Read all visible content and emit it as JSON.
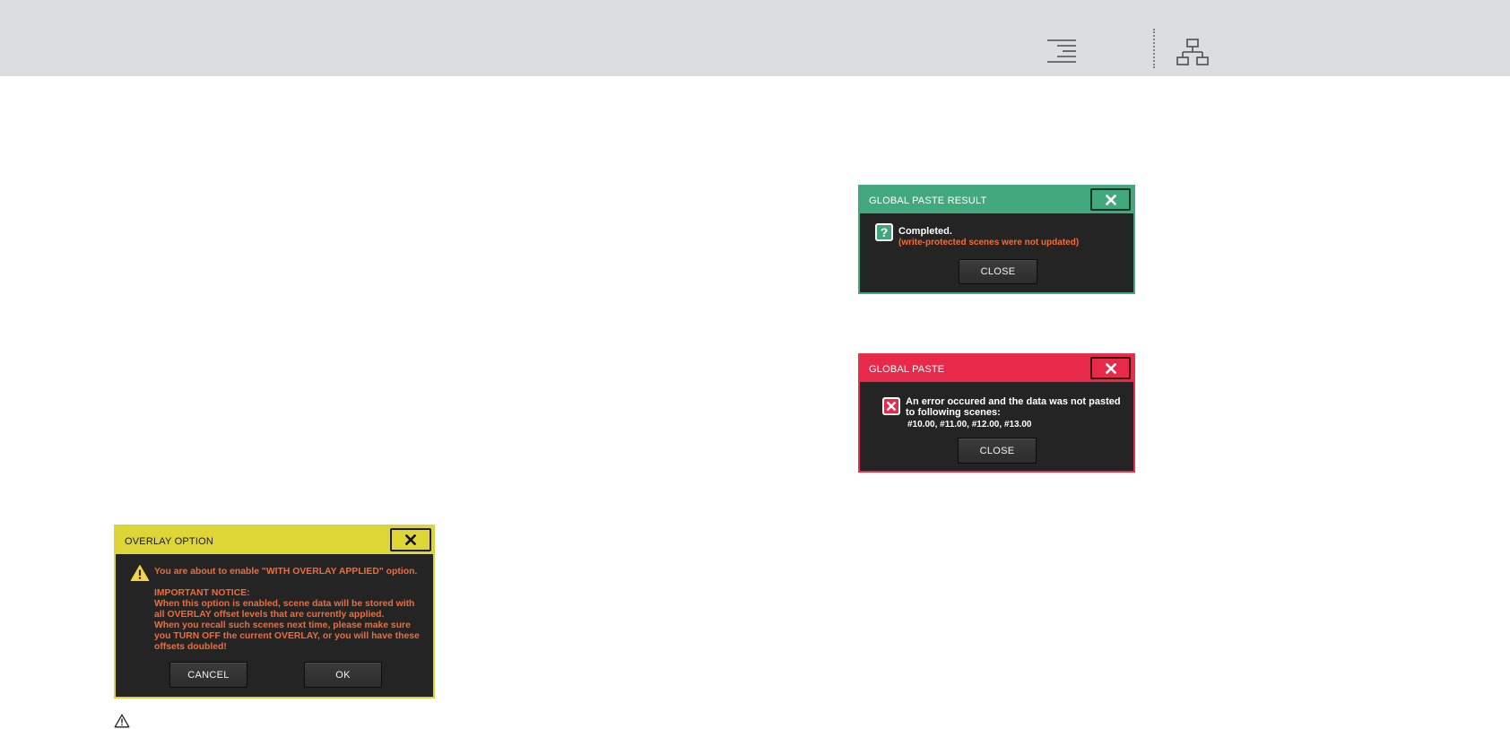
{
  "topbar": {
    "icons": [
      "menu-lines-icon",
      "network-tree-icon"
    ]
  },
  "global_paste_result": {
    "title": "GLOBAL PASTE RESULT",
    "icon": "question-icon",
    "message": "Completed.",
    "submessage": "(write-protected scenes were not updated)",
    "close_label": "CLOSE",
    "accent": "#41a97c"
  },
  "global_paste": {
    "title": "GLOBAL PASTE",
    "icon": "error-x-icon",
    "message_line1": "An error occured and the data was not pasted",
    "message_line2": "to following scenes:",
    "scenes": "#10.00, #11.00, #12.00, #13.00",
    "close_label": "CLOSE",
    "accent": "#e8294a"
  },
  "overlay_option": {
    "title": "OVERLAY OPTION",
    "icon": "warning-icon",
    "lines": [
      "You are about to enable \"WITH OVERLAY APPLIED\" option.",
      "IMPORTANT NOTICE:",
      "When this option is enabled, scene data will be stored with",
      "all OVERLAY offset levels that are currently applied.",
      "When you recall such scenes next time, please make sure",
      "you TURN OFF the current OVERLAY, or you will have these",
      "offsets doubled!"
    ],
    "cancel_label": "CANCEL",
    "ok_label": "OK",
    "accent": "#ded536",
    "text_color": "#f26b34"
  },
  "footer": {
    "icon": "warning-outline-icon"
  }
}
